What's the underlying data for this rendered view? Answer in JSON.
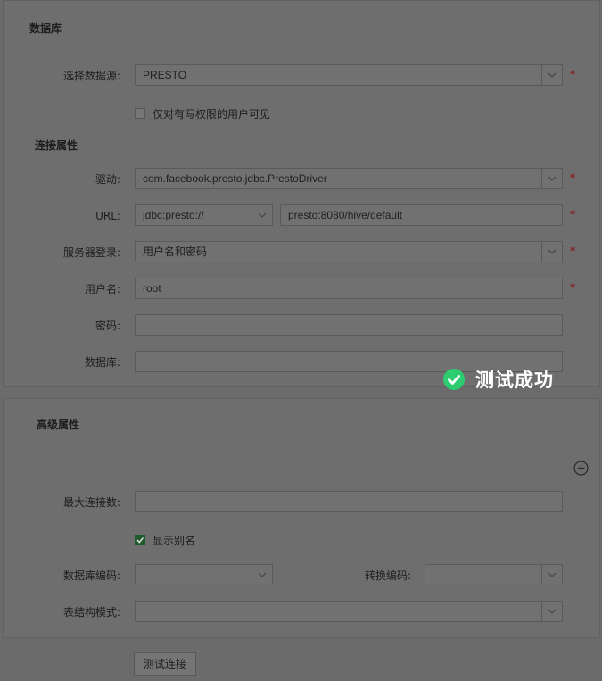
{
  "database_section": {
    "title": "数据库",
    "datasource_label": "选择数据源:",
    "datasource_value": "PRESTO",
    "write_perm_label": "仅对有写权限的用户可见"
  },
  "connection": {
    "title": "连接属性",
    "driver_label": "驱动:",
    "driver_value": "com.facebook.presto.jdbc.PrestoDriver",
    "url_label": "URL:",
    "url_prefix": "jdbc:presto://",
    "url_value": "presto:8080/hive/default",
    "login_label": "服务器登录:",
    "login_value": "用户名和密码",
    "username_label": "用户名:",
    "username_value": "root",
    "password_label": "密码:",
    "password_value": "",
    "database_label": "数据库:",
    "database_value": ""
  },
  "required_mark": "*",
  "toast": {
    "text": "测试成功",
    "color": "#2ecc71"
  },
  "advanced": {
    "title": "高级属性",
    "max_conn_label": "最大连接数:",
    "max_conn_value": "",
    "show_alias_label": "显示别名",
    "show_alias_checked": true,
    "db_encoding_label": "数据库编码:",
    "db_encoding_value": "",
    "convert_encoding_label": "转换编码:",
    "convert_encoding_value": "",
    "schema_label": "表结构模式:",
    "schema_value": ""
  },
  "test_button": "测试连接"
}
